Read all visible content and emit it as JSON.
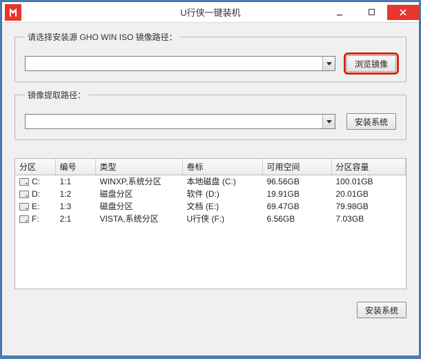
{
  "window": {
    "title": "U行侠一键装机"
  },
  "group1": {
    "legend": "请选择安装源 GHO WIN ISO 镜像路径：",
    "select_value": "",
    "browse_btn": "浏览镜像"
  },
  "group2": {
    "legend": "镜像提取路径：",
    "select_value": "",
    "install_btn": "安装系统"
  },
  "table": {
    "headers": {
      "partition": "分区",
      "number": "编号",
      "type": "类型",
      "volume": "卷标",
      "free": "可用空间",
      "size": "分区容量"
    },
    "rows": [
      {
        "partition": "C:",
        "number": "1:1",
        "type": "WINXP,系统分区",
        "volume": "本地磁盘 (C:)",
        "free": "96.56GB",
        "size": "100.01GB"
      },
      {
        "partition": "D:",
        "number": "1:2",
        "type": "磁盘分区",
        "volume": "软件 (D:)",
        "free": "19.91GB",
        "size": "20.01GB"
      },
      {
        "partition": "E:",
        "number": "1:3",
        "type": "磁盘分区",
        "volume": "文档 (E:)",
        "free": "69.47GB",
        "size": "79.98GB"
      },
      {
        "partition": "F:",
        "number": "2:1",
        "type": "VISTA,系统分区",
        "volume": "U行侠 (F:)",
        "free": "6.56GB",
        "size": "7.03GB"
      }
    ]
  },
  "footer": {
    "install_btn": "安装系统"
  }
}
